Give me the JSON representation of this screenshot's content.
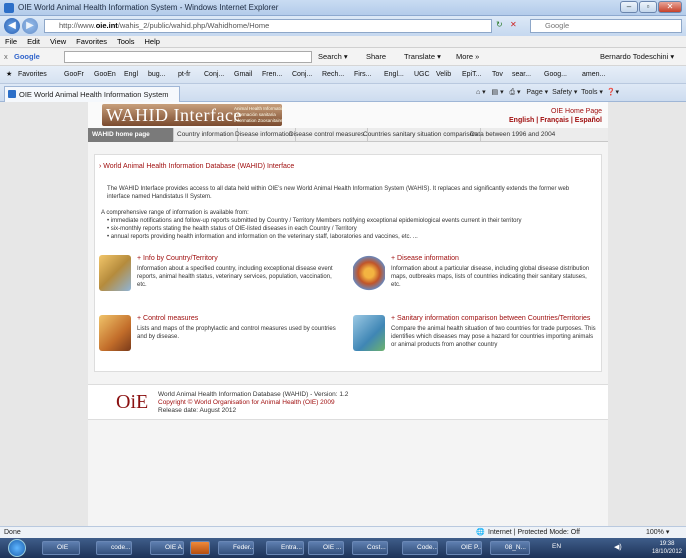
{
  "window": {
    "title": "OIE World Animal Health Information System - Windows Internet Explorer",
    "controls": [
      "–",
      "▫",
      "✕"
    ]
  },
  "address": {
    "prefix": "http://www.",
    "domain": "oie.int",
    "path": "/wahis_2/public/wahid.php/Wahidhome/Home",
    "search_engine": "Google"
  },
  "menu": [
    "File",
    "Edit",
    "View",
    "Favorites",
    "Tools",
    "Help"
  ],
  "googlebar": {
    "close": "x",
    "logo": "Google",
    "search": "Search ▾",
    "share": "Share",
    "translate": "Translate ▾",
    "more": "More »",
    "user": "Bernardo Todeschini ▾"
  },
  "favorites": {
    "label": "Favorites",
    "items": [
      "GooFr",
      "GooEn",
      "Engl",
      "bug...",
      "pt-fr",
      "Conj...",
      "Gmail",
      "Fren...",
      "Conj...",
      "Rech...",
      "Firs...",
      "Engl...",
      "UGC",
      "Velib",
      "EpiT...",
      "Tov",
      "sear...",
      "Goog...",
      "amen..."
    ]
  },
  "tab": {
    "title": "OIE World Animal Health Information System"
  },
  "commands": [
    "Page ▾",
    "Safety ▾",
    "Tools ▾"
  ],
  "site": {
    "logo_word": "WAHID Interface",
    "logo_sub": [
      "Animal Health Information",
      "Información sanitaria",
      "Information Zoosanitaire"
    ],
    "oie_home": "OIE Home Page",
    "languages": "English | Français | Español",
    "nav": [
      "WAHID home page",
      "Country information",
      "Disease information",
      "Disease control measures",
      "Countries sanitary situation comparison",
      "Data between 1996 and 2004"
    ],
    "main_title": "› World Animal Health Information Database (WAHID) Interface",
    "intro": "The WAHID Interface provides access to all data held within OIE's new World Animal Health Information System (WAHIS). It replaces and significantly extends the former web interface named Handistatus II System.",
    "range_intro": "A comprehensive range of information is available from:",
    "bullets": [
      "• immediate notifications and follow-up reports submitted by Country / Territory Members notifying exceptional epidemiological events current in their territory",
      "• six-monthly reports stating the health status of OIE-listed diseases in each Country / Territory",
      "• annual reports providing health information and information on the veterinary staff, laboratories and vaccines, etc. ..."
    ],
    "cells": [
      {
        "title": "+ Info by Country/Territory",
        "desc": "Information about a specified country, including exceptional disease event reports, animal health status, veterinary services, population, vaccination, etc."
      },
      {
        "title": "+ Disease information",
        "desc": "Information about a particular disease, including global disease distribution maps, outbreaks maps, lists of countries indicating their sanitary statuses, etc."
      },
      {
        "title": "+ Control measures",
        "desc": "Lists and maps of the prophylactic and control measures used by countries and by disease."
      },
      {
        "title": "+ Sanitary information comparison between Countries/Territories",
        "desc": "Compare the animal health situation of two countries for trade purposes. This identifies which diseases may pose a hazard for countries importing animals or animal products from another country"
      }
    ],
    "footer": {
      "logo": "OiE",
      "line1": "World Animal Health Information Database (WAHID) - Version: 1.2",
      "line2": "Copyright © World Organisation for Animal Health (OIE) 2009",
      "line3": "Release date: August 2012"
    }
  },
  "status": {
    "left": "Done",
    "zone": "Internet | Protected Mode: Off",
    "zoom": "100% ▾"
  },
  "taskbar": {
    "items": [
      "OIE",
      "code...",
      "OIE A...",
      "",
      "Feder...",
      "Entra...",
      "OIE ...",
      "Cost...",
      "Code...",
      "OIE P...",
      "08_N..."
    ],
    "lang": "EN",
    "time": "19:38",
    "date": "18/10/2012"
  }
}
